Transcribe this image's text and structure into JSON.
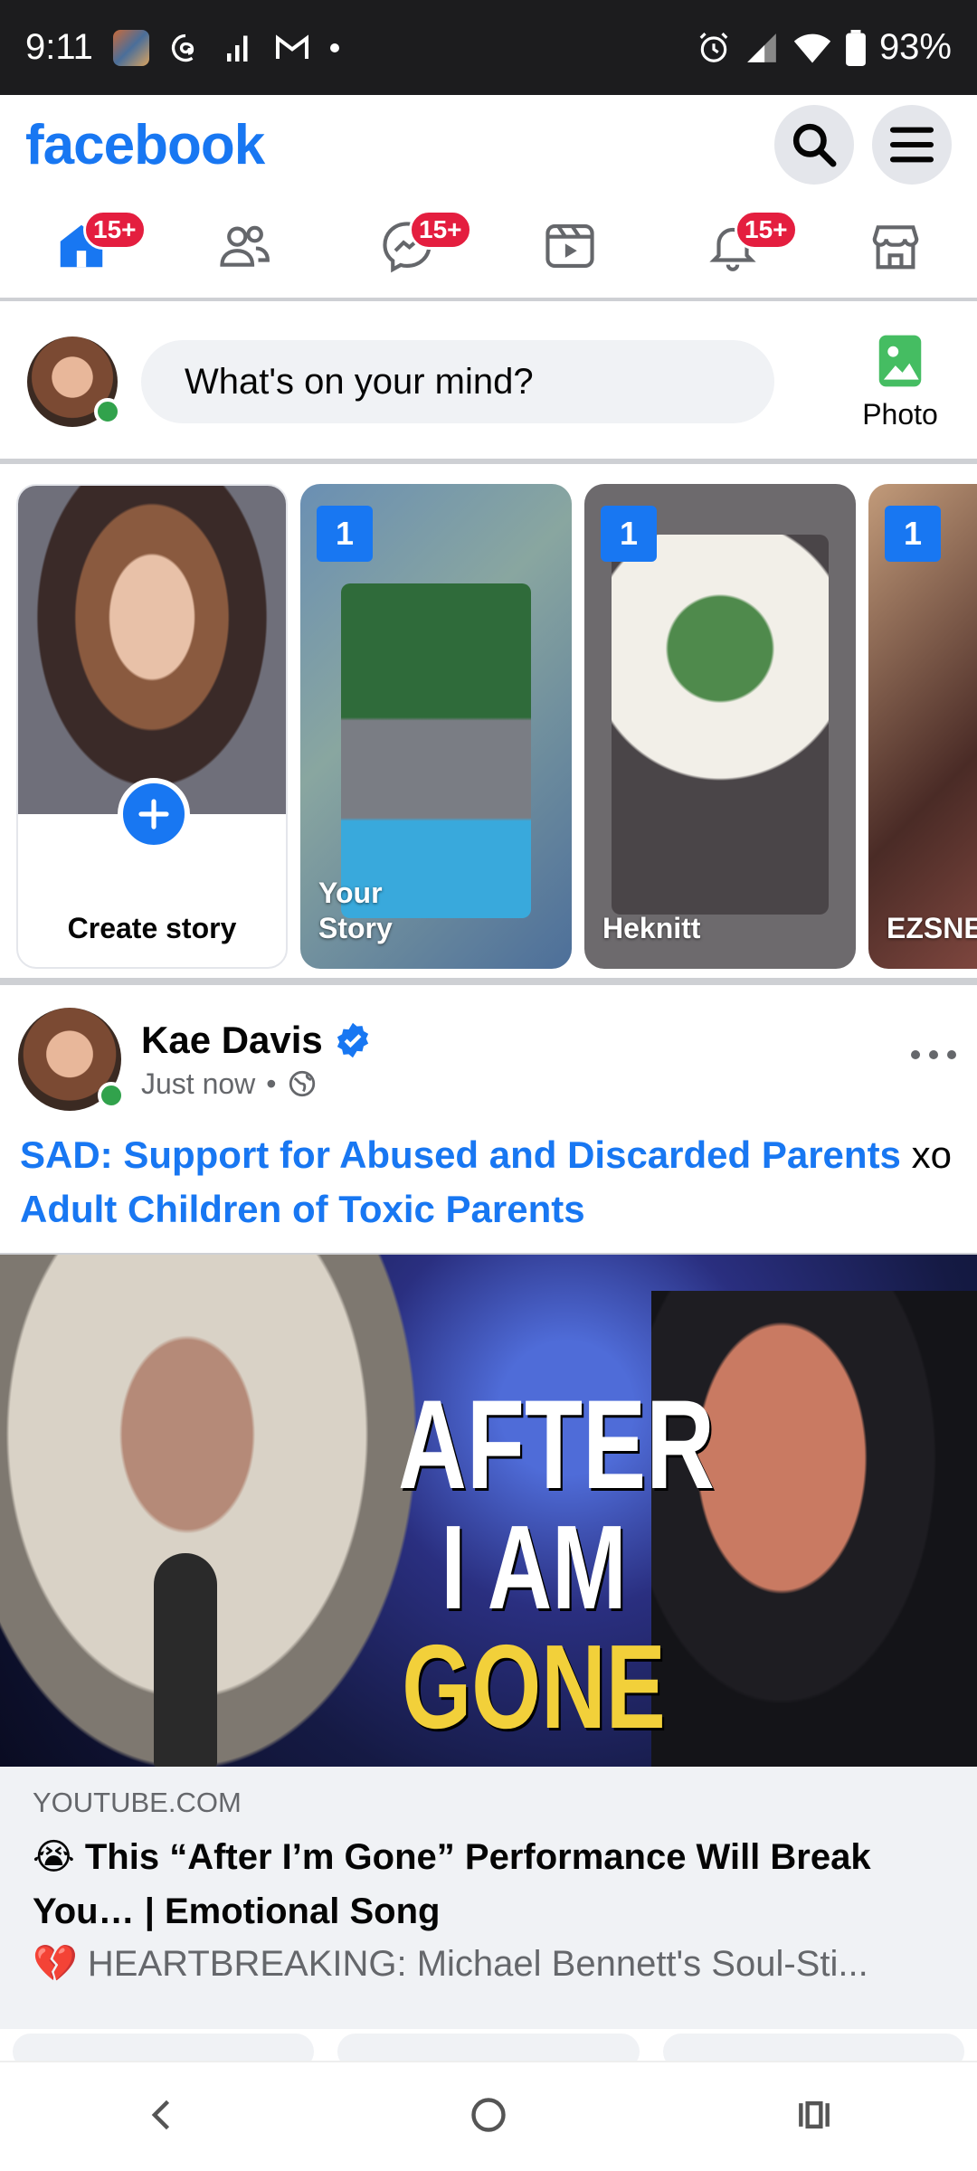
{
  "status": {
    "time": "9:11",
    "battery": "93%"
  },
  "header": {
    "logo": "facebook"
  },
  "nav": {
    "tabs": [
      {
        "icon": "home-icon",
        "badge": "15+"
      },
      {
        "icon": "friends-icon",
        "badge": ""
      },
      {
        "icon": "messenger-icon",
        "badge": "15+"
      },
      {
        "icon": "video-icon",
        "badge": ""
      },
      {
        "icon": "bell-icon",
        "badge": "15+"
      },
      {
        "icon": "marketplace-icon",
        "badge": ""
      }
    ]
  },
  "composer": {
    "placeholder": "What's on your mind?",
    "photo_label": "Photo"
  },
  "stories": {
    "create_label": "Create story",
    "items": [
      {
        "name": "Your Story",
        "count": "1"
      },
      {
        "name": "Heknitt",
        "count": "1"
      },
      {
        "name": "EZSNE",
        "count": "1"
      }
    ]
  },
  "post": {
    "author": "Kae Davis",
    "time": "Just now",
    "link1": "SAD: Support for Abused and Discarded Parents",
    "connector": "xo",
    "link2": "Adult Children of Toxic Parents",
    "image_text_line1": "AFTER",
    "image_text_line2a": "I AM",
    "image_text_line2b": "GONE",
    "preview": {
      "domain": "YOUTUBE.COM",
      "title": "😭 This “After I’m Gone” Performance Will Break You… | Emotional Song",
      "description": "💔 HEARTBREAKING: Michael Bennett's Soul-Sti..."
    }
  },
  "colors": {
    "brand": "#1877f2",
    "badge": "#e41e3f",
    "online": "#31a24c"
  }
}
